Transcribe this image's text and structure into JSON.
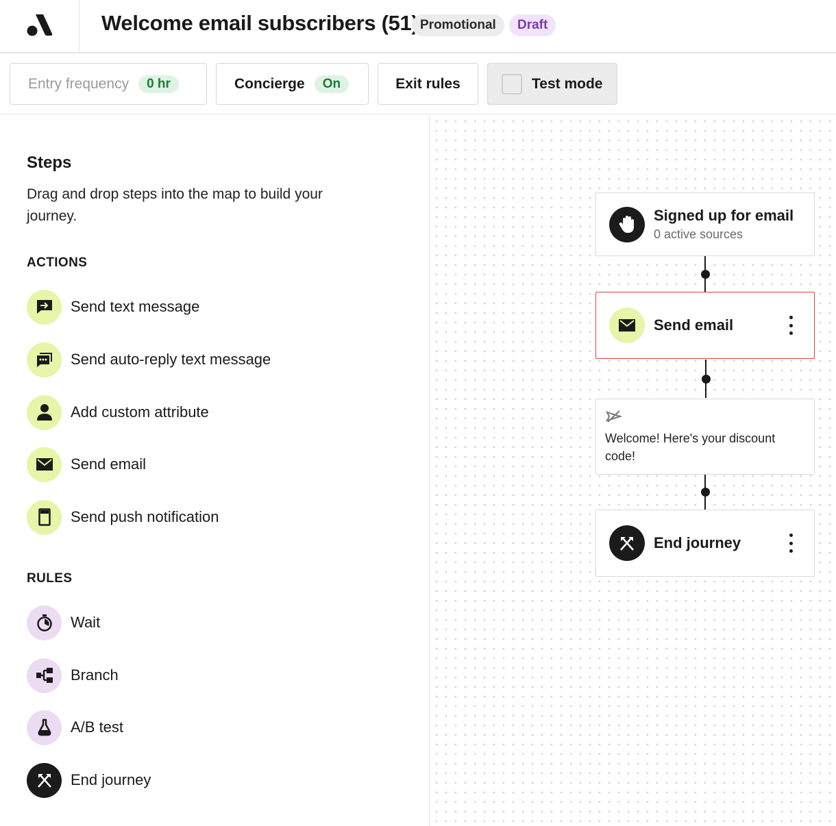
{
  "header": {
    "logo_icon": "brand-logo-icon",
    "title": "Welcome email subscribers (51)",
    "badges": {
      "promotional": "Promotional",
      "draft": "Draft"
    }
  },
  "toolbar": {
    "entry_frequency": {
      "label": "Entry frequency",
      "value": "0 hr"
    },
    "concierge": {
      "label": "Concierge",
      "value": "On"
    },
    "exit_rules": {
      "label": "Exit rules"
    },
    "test_mode": {
      "label": "Test mode",
      "checked": false
    }
  },
  "steps_panel": {
    "title": "Steps",
    "description": "Drag and drop steps into the map to build your journey.",
    "actions": {
      "heading": "ACTIONS",
      "items": [
        {
          "label": "Send text message",
          "icon": "text-message-icon"
        },
        {
          "label": "Send auto-reply text message",
          "icon": "auto-reply-icon"
        },
        {
          "label": "Add custom attribute",
          "icon": "person-icon"
        },
        {
          "label": "Send email",
          "icon": "envelope-icon"
        },
        {
          "label": "Send push notification",
          "icon": "phone-icon"
        }
      ]
    },
    "rules": {
      "heading": "RULES",
      "items": [
        {
          "label": "Wait",
          "icon": "timer-icon"
        },
        {
          "label": "Branch",
          "icon": "branch-icon"
        },
        {
          "label": "A/B test",
          "icon": "flask-icon"
        },
        {
          "label": "End journey",
          "icon": "crossed-axes-icon"
        }
      ]
    }
  },
  "journey_map": {
    "trigger": {
      "title": "Signed up for email",
      "subtitle": "0 active sources",
      "icon": "waving-hand-icon"
    },
    "send_email": {
      "title": "Send email",
      "icon": "envelope-icon",
      "selected": true
    },
    "email_preview": {
      "text": "Welcome! Here's your discount code!",
      "icon": "send-off-icon"
    },
    "end": {
      "title": "End journey",
      "icon": "crossed-axes-icon"
    }
  },
  "colors": {
    "action_icon_bg": "#e6f5a8",
    "rule_icon_bg": "#ecdcf2",
    "draft_badge_bg": "#f0e3fa",
    "draft_badge_text": "#7a3cae",
    "on_pill_bg": "#dff3e4",
    "on_pill_text": "#1f7a3a",
    "selected_node_border": "#d9453b"
  }
}
